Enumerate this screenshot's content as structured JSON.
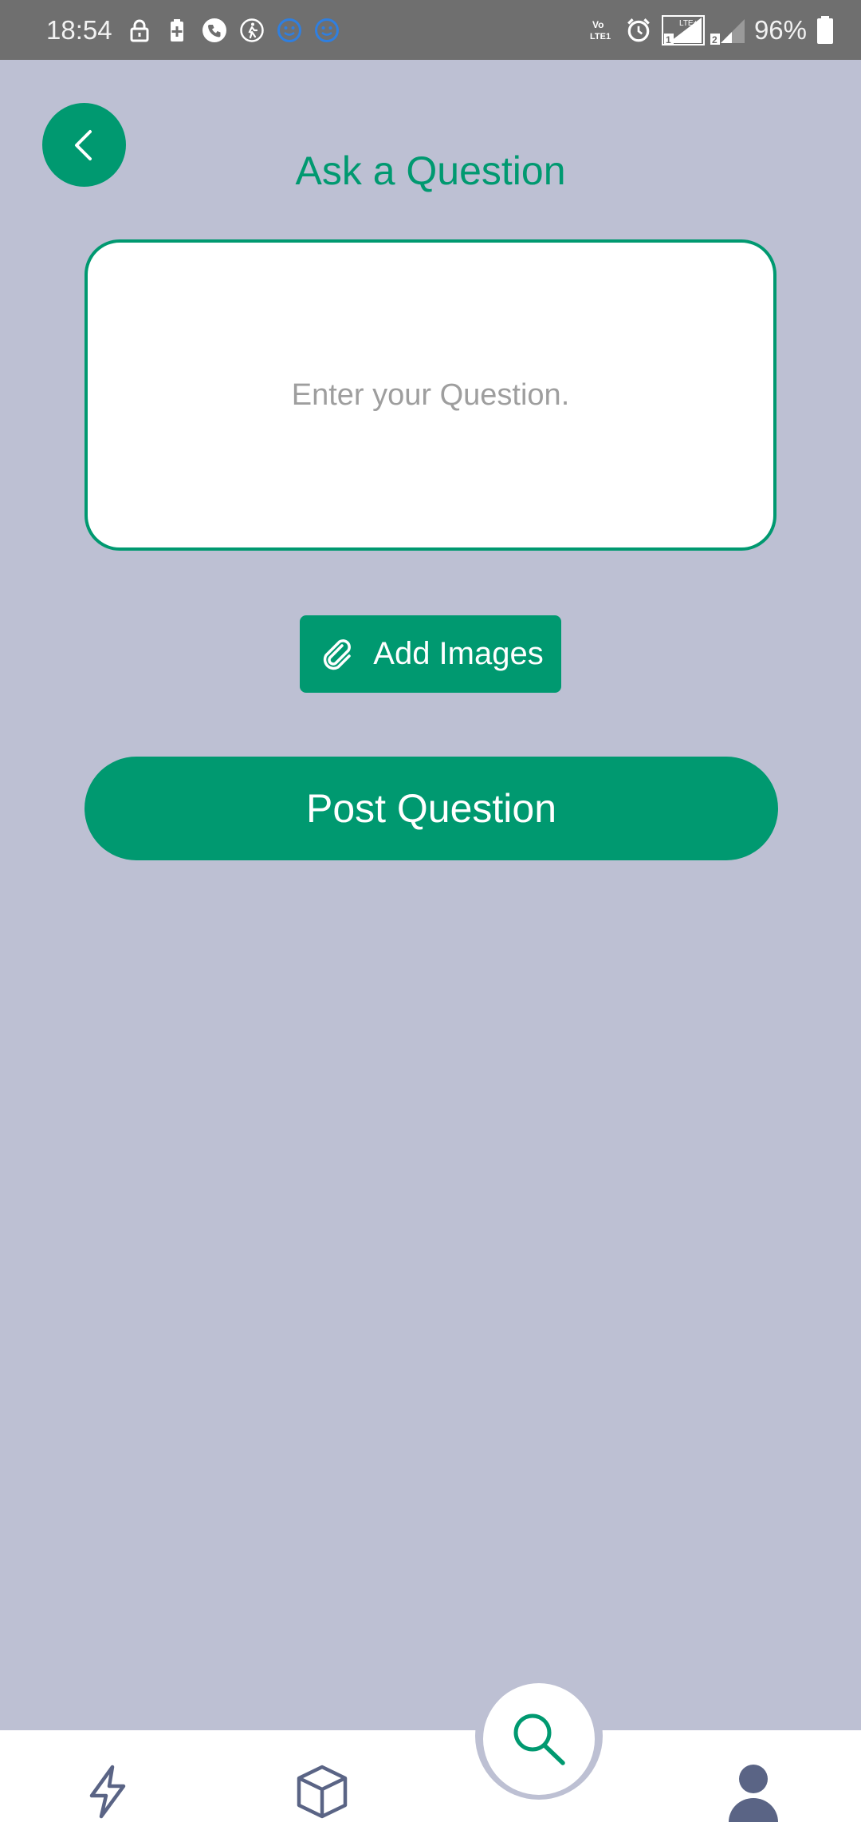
{
  "status_bar": {
    "time": "18:54",
    "battery_percent": "96%",
    "left_icons": [
      "lock-icon",
      "battery-saver-icon",
      "phone-call-icon",
      "step-counter-icon",
      "emoji-face-icon",
      "emoji-face-icon"
    ],
    "right_icons": [
      "volte-icon",
      "alarm-icon",
      "signal-sim1-icon",
      "signal-sim2-icon",
      "battery-icon"
    ]
  },
  "header": {
    "title": "Ask a Question",
    "back_icon": "chevron-left-icon"
  },
  "question": {
    "placeholder": "Enter your Question.",
    "value": ""
  },
  "actions": {
    "add_images_label": "Add Images",
    "add_images_icon": "paperclip-icon",
    "post_label": "Post Question"
  },
  "bottom_nav": {
    "items": [
      {
        "icon": "lightning-icon"
      },
      {
        "icon": "cube-icon"
      },
      {
        "icon": "search-icon",
        "active": true
      },
      {
        "icon": "user-icon"
      }
    ]
  },
  "colors": {
    "accent": "#009970",
    "background": "#bdc0d3",
    "status_bar": "#6f6f6f",
    "nav_icon": "#5a6485",
    "placeholder": "#9e9e9e"
  }
}
